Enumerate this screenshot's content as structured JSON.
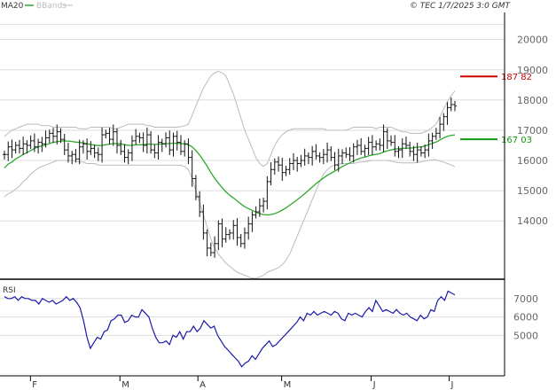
{
  "header": {
    "legend": [
      {
        "label": "MA20",
        "color": "#2ea82e"
      },
      {
        "label": "BBands",
        "color": "#bbbbbb"
      }
    ],
    "timestamp": "© TEC 1/7/2025 3:0 GMT"
  },
  "chart_data": [
    {
      "type": "ohlc",
      "title": "",
      "xlabel": "",
      "ylabel": "",
      "months": [
        "F",
        "M",
        "A",
        "M",
        "J",
        "J"
      ],
      "ylim": [
        12100,
        20900
      ],
      "yticks": [
        {
          "label": "20000",
          "value": 20000
        },
        {
          "label": "19000",
          "value": 19000
        },
        {
          "label": "18000",
          "value": 18000
        },
        {
          "label": "17000",
          "value": 17000
        },
        {
          "label": "16000",
          "value": 16000
        },
        {
          "label": "15000",
          "value": 15000
        },
        {
          "label": "14000",
          "value": 14000
        }
      ],
      "grid": true,
      "series": [
        {
          "name": "",
          "close": [
            16200,
            16450,
            16350,
            16500,
            16400,
            16550,
            16500,
            16650,
            16450,
            16600,
            16550,
            16750,
            16900,
            16800,
            16950,
            16700,
            16350,
            16150,
            16200,
            16050,
            16450,
            16550,
            16300,
            16400,
            16250,
            16200,
            16850,
            16900,
            16700,
            16950,
            16500,
            16300,
            16100,
            16250,
            16650,
            16800,
            16750,
            16500,
            16850,
            16350,
            16250,
            16600,
            16550,
            16750,
            16350,
            16800,
            16600,
            16300,
            16550,
            16100,
            15400,
            14800,
            14300,
            13600,
            13100,
            12950,
            13250,
            13900,
            13400,
            13550,
            13600,
            13850,
            13450,
            13250,
            13600,
            13900,
            14200,
            14300,
            14500,
            14650,
            15300,
            15700,
            15950,
            15850,
            15600,
            15700,
            15900,
            16000,
            15900,
            16000,
            16150,
            16100,
            16300,
            16150,
            16100,
            16200,
            16350,
            16100,
            15850,
            16150,
            16250,
            16200,
            16150,
            16450,
            16500,
            16300,
            16400,
            16600,
            16450,
            16550,
            16500,
            16950,
            16650,
            16600,
            16300,
            16350,
            16550,
            16500,
            16300,
            16200,
            16350,
            16250,
            16350,
            16650,
            16800,
            16900,
            17200,
            17450,
            17750,
            17850,
            17800
          ],
          "ma20": [
            15750,
            15880,
            15950,
            16050,
            16120,
            16200,
            16260,
            16330,
            16400,
            16450,
            16480,
            16520,
            16560,
            16600,
            16620,
            16640,
            16650,
            16640,
            16630,
            16610,
            16600,
            16580,
            16550,
            16530,
            16510,
            16490,
            16500,
            16520,
            16540,
            16560,
            16560,
            16550,
            16520,
            16500,
            16500,
            16520,
            16520,
            16520,
            16540,
            16540,
            16530,
            16540,
            16550,
            16560,
            16560,
            16570,
            16570,
            16560,
            16550,
            16520,
            16450,
            16330,
            16180,
            16000,
            15810,
            15600,
            15410,
            15250,
            15100,
            14960,
            14850,
            14760,
            14660,
            14560,
            14470,
            14410,
            14350,
            14290,
            14240,
            14210,
            14200,
            14210,
            14240,
            14290,
            14360,
            14430,
            14520,
            14610,
            14700,
            14800,
            14900,
            15010,
            15120,
            15230,
            15330,
            15420,
            15510,
            15580,
            15650,
            15720,
            15800,
            15860,
            15920,
            15980,
            16040,
            16080,
            16110,
            16150,
            16180,
            16200,
            16230,
            16280,
            16320,
            16350,
            16380,
            16390,
            16400,
            16410,
            16410,
            16420,
            16440,
            16450,
            16480,
            16520,
            16570,
            16610,
            16680,
            16750,
            16800,
            16830,
            16850
          ],
          "bb_upper": [
            16800,
            16900,
            17000,
            17050,
            17100,
            17150,
            17200,
            17200,
            17200,
            17200,
            17150,
            17150,
            17150,
            17100,
            17100,
            17100,
            17100,
            17100,
            17100,
            17100,
            17050,
            17050,
            17050,
            17100,
            17100,
            17100,
            17100,
            17100,
            17100,
            17050,
            17050,
            17100,
            17150,
            17200,
            17200,
            17200,
            17200,
            17200,
            17150,
            17150,
            17100,
            17100,
            17100,
            17100,
            17100,
            17100,
            17100,
            17120,
            17150,
            17200,
            17500,
            17800,
            18100,
            18400,
            18600,
            18800,
            18900,
            18950,
            18900,
            18800,
            18500,
            18200,
            17800,
            17400,
            17000,
            16700,
            16400,
            16100,
            15900,
            15800,
            15900,
            16200,
            16500,
            16700,
            16850,
            16950,
            17000,
            17050,
            17050,
            17050,
            17050,
            17050,
            17050,
            17050,
            17050,
            17050,
            17000,
            17000,
            17000,
            17000,
            17000,
            17000,
            17050,
            17100,
            17100,
            17100,
            17100,
            17100,
            17100,
            17050,
            17100,
            17100,
            17100,
            17100,
            17050,
            17000,
            16950,
            16950,
            16900,
            16900,
            16900,
            16900,
            16950,
            17000,
            17100,
            17200,
            17450,
            17700,
            17950,
            18150,
            18300
          ],
          "bb_lower": [
            14800,
            14900,
            14950,
            15050,
            15150,
            15300,
            15400,
            15550,
            15650,
            15750,
            15800,
            15850,
            15900,
            15950,
            16000,
            16000,
            16000,
            16000,
            16000,
            15980,
            15950,
            15950,
            15900,
            15900,
            15900,
            15850,
            15850,
            15850,
            15850,
            15850,
            15850,
            15850,
            15850,
            15850,
            15850,
            15850,
            15850,
            15850,
            15850,
            15850,
            15850,
            15850,
            15850,
            15850,
            15850,
            15850,
            15850,
            15840,
            15800,
            15700,
            15400,
            15000,
            14600,
            14200,
            13800,
            13400,
            13100,
            12900,
            12750,
            12600,
            12500,
            12400,
            12300,
            12250,
            12200,
            12150,
            12100,
            12100,
            12150,
            12200,
            12300,
            12350,
            12400,
            12450,
            12550,
            12700,
            12900,
            13200,
            13500,
            13800,
            14100,
            14400,
            14700,
            15000,
            15300,
            15550,
            15700,
            15800,
            15850,
            15880,
            15900,
            15900,
            15900,
            15900,
            15930,
            15950,
            15960,
            15980,
            16000,
            16000,
            16000,
            16000,
            16000,
            15980,
            15950,
            15930,
            15920,
            15920,
            15920,
            15920,
            15930,
            15950,
            15980,
            16000,
            16020,
            16020,
            15980,
            15950,
            15900,
            15850,
            15800
          ]
        }
      ],
      "markers": [
        {
          "label": "187 82",
          "value": 18782,
          "color": "#cc0000"
        },
        {
          "label": "167 03",
          "value": 16703,
          "color": "#119911"
        }
      ]
    },
    {
      "type": "line",
      "title": "",
      "ylabel": "RSI",
      "ylim": [
        30,
        80
      ],
      "yticks": [
        {
          "label": "7000",
          "value": 70
        },
        {
          "label": "6000",
          "value": 60
        },
        {
          "label": "5000",
          "value": 50
        }
      ],
      "grid": true,
      "series": [
        {
          "name": "",
          "color": "#1a1aa8",
          "values": [
            71,
            70,
            70,
            71,
            69,
            71,
            70,
            70,
            69,
            69,
            67,
            70,
            69,
            68,
            69,
            67,
            68,
            69,
            71,
            69,
            70,
            68,
            65,
            58,
            49,
            43,
            46,
            49,
            48,
            52,
            53,
            58,
            59,
            61,
            61,
            57,
            58,
            61,
            60,
            60,
            64,
            62,
            60,
            54,
            49,
            46,
            46,
            47,
            45,
            50,
            49,
            52,
            48,
            52,
            52,
            55,
            52,
            54,
            58,
            56,
            54,
            55,
            50,
            47,
            44,
            42,
            40,
            38,
            36,
            33,
            35,
            36,
            39,
            37,
            40,
            43,
            45,
            47,
            44,
            45,
            47,
            49,
            51,
            53,
            55,
            57,
            60,
            58,
            62,
            61,
            63,
            61,
            62,
            63,
            62,
            61,
            63,
            62,
            59,
            58,
            62,
            61,
            62,
            61,
            60,
            63,
            65,
            63,
            69,
            66,
            63,
            64,
            63,
            62,
            64,
            62,
            61,
            62,
            60,
            59,
            58,
            61,
            59,
            60,
            64,
            63,
            69,
            71,
            69,
            74,
            73,
            72
          ]
        }
      ]
    }
  ]
}
